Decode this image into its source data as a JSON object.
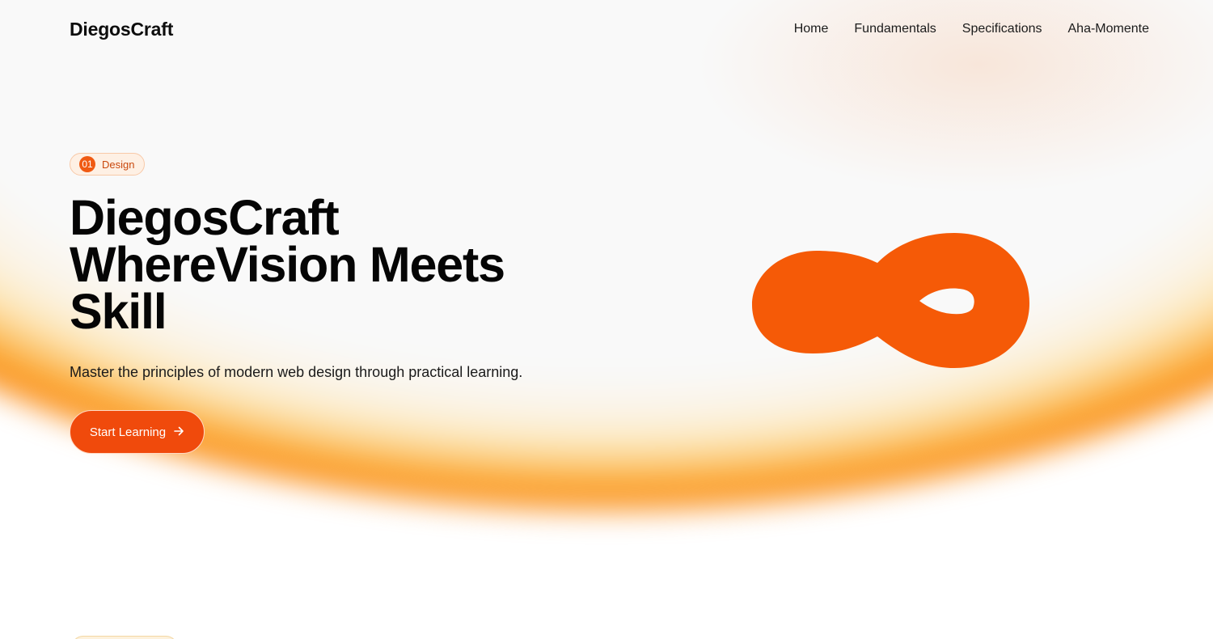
{
  "brand": {
    "name": "DiegosCraft"
  },
  "nav": {
    "items": [
      {
        "label": "Home"
      },
      {
        "label": "Fundamentals"
      },
      {
        "label": "Specifications"
      },
      {
        "label": "Aha-Momente"
      }
    ]
  },
  "hero": {
    "badge": {
      "number": "01",
      "label": "Design"
    },
    "title_lines": [
      "DiegosCraft",
      "WhereVision Meets",
      "Skill"
    ],
    "subtitle": "Master the principles of modern web design through practical learning.",
    "cta": {
      "label": "Start Learning",
      "icon": "arrow-right-icon"
    }
  },
  "colors": {
    "accent": "#f05a12",
    "button": "#f04a0c",
    "shape": "#f55a07"
  }
}
